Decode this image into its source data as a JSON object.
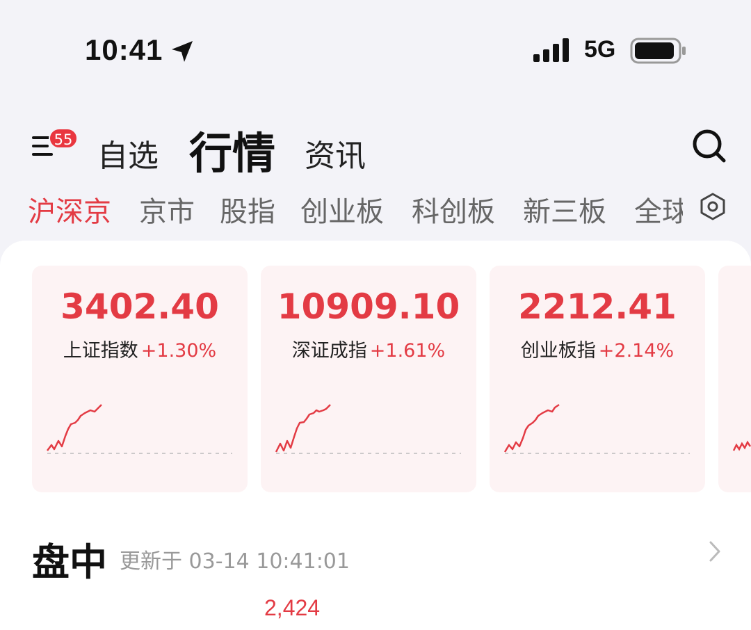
{
  "status_bar": {
    "time": "10:41",
    "network": "5G",
    "icons": [
      "location-arrow-icon",
      "signal-bars-icon",
      "battery-icon"
    ]
  },
  "header": {
    "menu_badge": "55",
    "nav_tabs": [
      {
        "label": "自选"
      },
      {
        "label": "行情",
        "active": true
      },
      {
        "label": "资讯"
      }
    ],
    "icons": [
      "menu-icon",
      "search-icon"
    ]
  },
  "market_tabs": [
    {
      "label": "沪深京",
      "active": true
    },
    {
      "label": "京市"
    },
    {
      "label": "股指"
    },
    {
      "label": "创业板"
    },
    {
      "label": "科创板"
    },
    {
      "label": "新三板"
    },
    {
      "label": "全球"
    }
  ],
  "index_cards": [
    {
      "value": "3402.40",
      "name": "上证指数",
      "change": "+1.30%"
    },
    {
      "value": "10909.10",
      "name": "深证成指",
      "change": "+1.61%"
    },
    {
      "value": "2212.41",
      "name": "创业板指",
      "change": "+2.14%"
    }
  ],
  "intraday": {
    "title": "盘中",
    "updated": "更新于 03-14 10:41:01",
    "count": "2,424"
  },
  "colors": {
    "up_red": "#e33b44",
    "badge_red": "#e9363f",
    "card_bg": "#fdf3f4",
    "page_bg": "#f3f3f8"
  }
}
